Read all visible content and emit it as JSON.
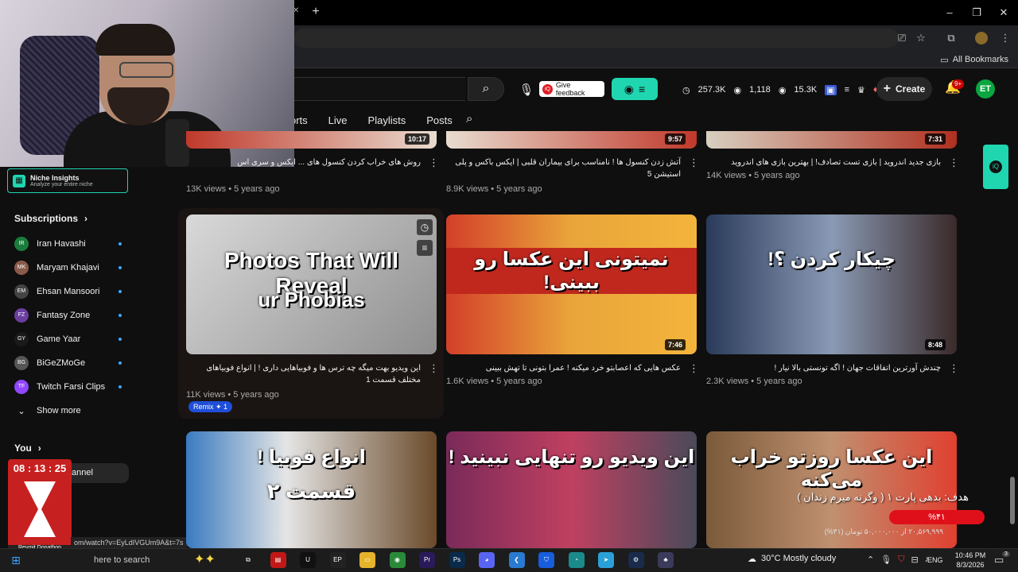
{
  "browser": {
    "new_tab_icon": "plus-icon",
    "bookmarks_label": "All Bookmarks",
    "window_controls": [
      "–",
      "❐",
      "✕"
    ]
  },
  "header": {
    "feedback_label": "Give feedback",
    "stats": [
      "257.3K",
      "1,118",
      "15.3K"
    ],
    "create_label": "Create",
    "notifications_badge": "9+",
    "avatar_initials": "ET"
  },
  "tabs": [
    "orts",
    "Live",
    "Playlists",
    "Posts"
  ],
  "sidebar": {
    "niche_title": "Niche Insights",
    "niche_subtitle": "Analyze your entire niche",
    "subscriptions_label": "Subscriptions",
    "subscriptions": [
      {
        "name": "Iran Havashi",
        "initials": "IR",
        "color": "#1b7d3c"
      },
      {
        "name": "Maryam Khajavi",
        "initials": "MK",
        "color": "#8a5a4a"
      },
      {
        "name": "Ehsan Mansoori",
        "initials": "EM",
        "color": "#444"
      },
      {
        "name": "Fantasy Zone",
        "initials": "FZ",
        "color": "#6b3fa0"
      },
      {
        "name": "Game Yaar",
        "initials": "GY",
        "color": "#1a1a1a"
      },
      {
        "name": "BiGeZMoGe",
        "initials": "BG",
        "color": "#555"
      },
      {
        "name": "Twitch Farsi Clips",
        "initials": "TF",
        "color": "#9146ff"
      }
    ],
    "show_more_label": "Show more",
    "you_label": "You",
    "channel_label": "annel"
  },
  "timer": {
    "time": "08 : 13 : 25",
    "name": "Reymit Donathon"
  },
  "status_url": "om/watch?v=EyLdIVGUm9A&t=7s",
  "videos": [
    {
      "title": "روش های خراب کردن کنسول های ... ایکس و سری اس",
      "meta": "13K views • 5 years ago",
      "duration": "10:17"
    },
    {
      "title": "آتش زدن کنسول ها ! نامناسب برای بیماران قلبی | ایکس باکس و پلی استیشن 5",
      "meta": "8.9K views • 5 years ago",
      "duration": "9:57"
    },
    {
      "title": "بازی جدید اندروید | بازی تست تصادف! | بهترین بازی های اندروید",
      "meta": "14K views • 5 years ago",
      "duration": "7:31"
    },
    {
      "title": "این ویدیو بهت میگه چه ترس ها و فوبیاهایی داری ! | انواع فوبیاهای مختلف قسمت 1",
      "meta": "11K views • 5 years ago",
      "duration": "",
      "thumb_text": "Photos That Will Reveal",
      "thumb_text2": "ur Phobias",
      "remix": "Remix ✦ 1"
    },
    {
      "title": "عکس هایی که اعصابتو خرد میکنه ! عمرا بتونی تا تهش ببینی",
      "meta": "1.6K views • 5 years ago",
      "duration": "7:46",
      "thumb_text": "نمیتونی این عکسا رو ببینی!"
    },
    {
      "title": "چندش آورترین اتفاقات جهان ! اگه تونستی بالا نیار !",
      "meta": "2.3K views • 5 years ago",
      "duration": "8:48",
      "thumb_text": "چیکار کردن ؟!"
    },
    {
      "thumb_text": "انواع فوبیا !",
      "thumb_text2": "قسمت ۲"
    },
    {
      "thumb_text": "این ویدیو رو تنهایی نبینید !"
    },
    {
      "thumb_text": "این عکسا روزتو خراب می‌کنه"
    }
  ],
  "goal": {
    "title": "هدف: بدهی پارت ۱ ( وگرنه میرم زندان )",
    "percent": "%۴۱",
    "sub": "۲۰,۵۶۹,۹۹۹ از ۵۰,۰۰۰,۰۰۰ تومان (۴۱%)"
  },
  "taskbar": {
    "search_placeholder": "here to search",
    "weather": "30°C  Mostly cloudy",
    "lang": "ENG",
    "time": "10:46 PM",
    "date": "8/3/2026",
    "notif_count": "3"
  }
}
